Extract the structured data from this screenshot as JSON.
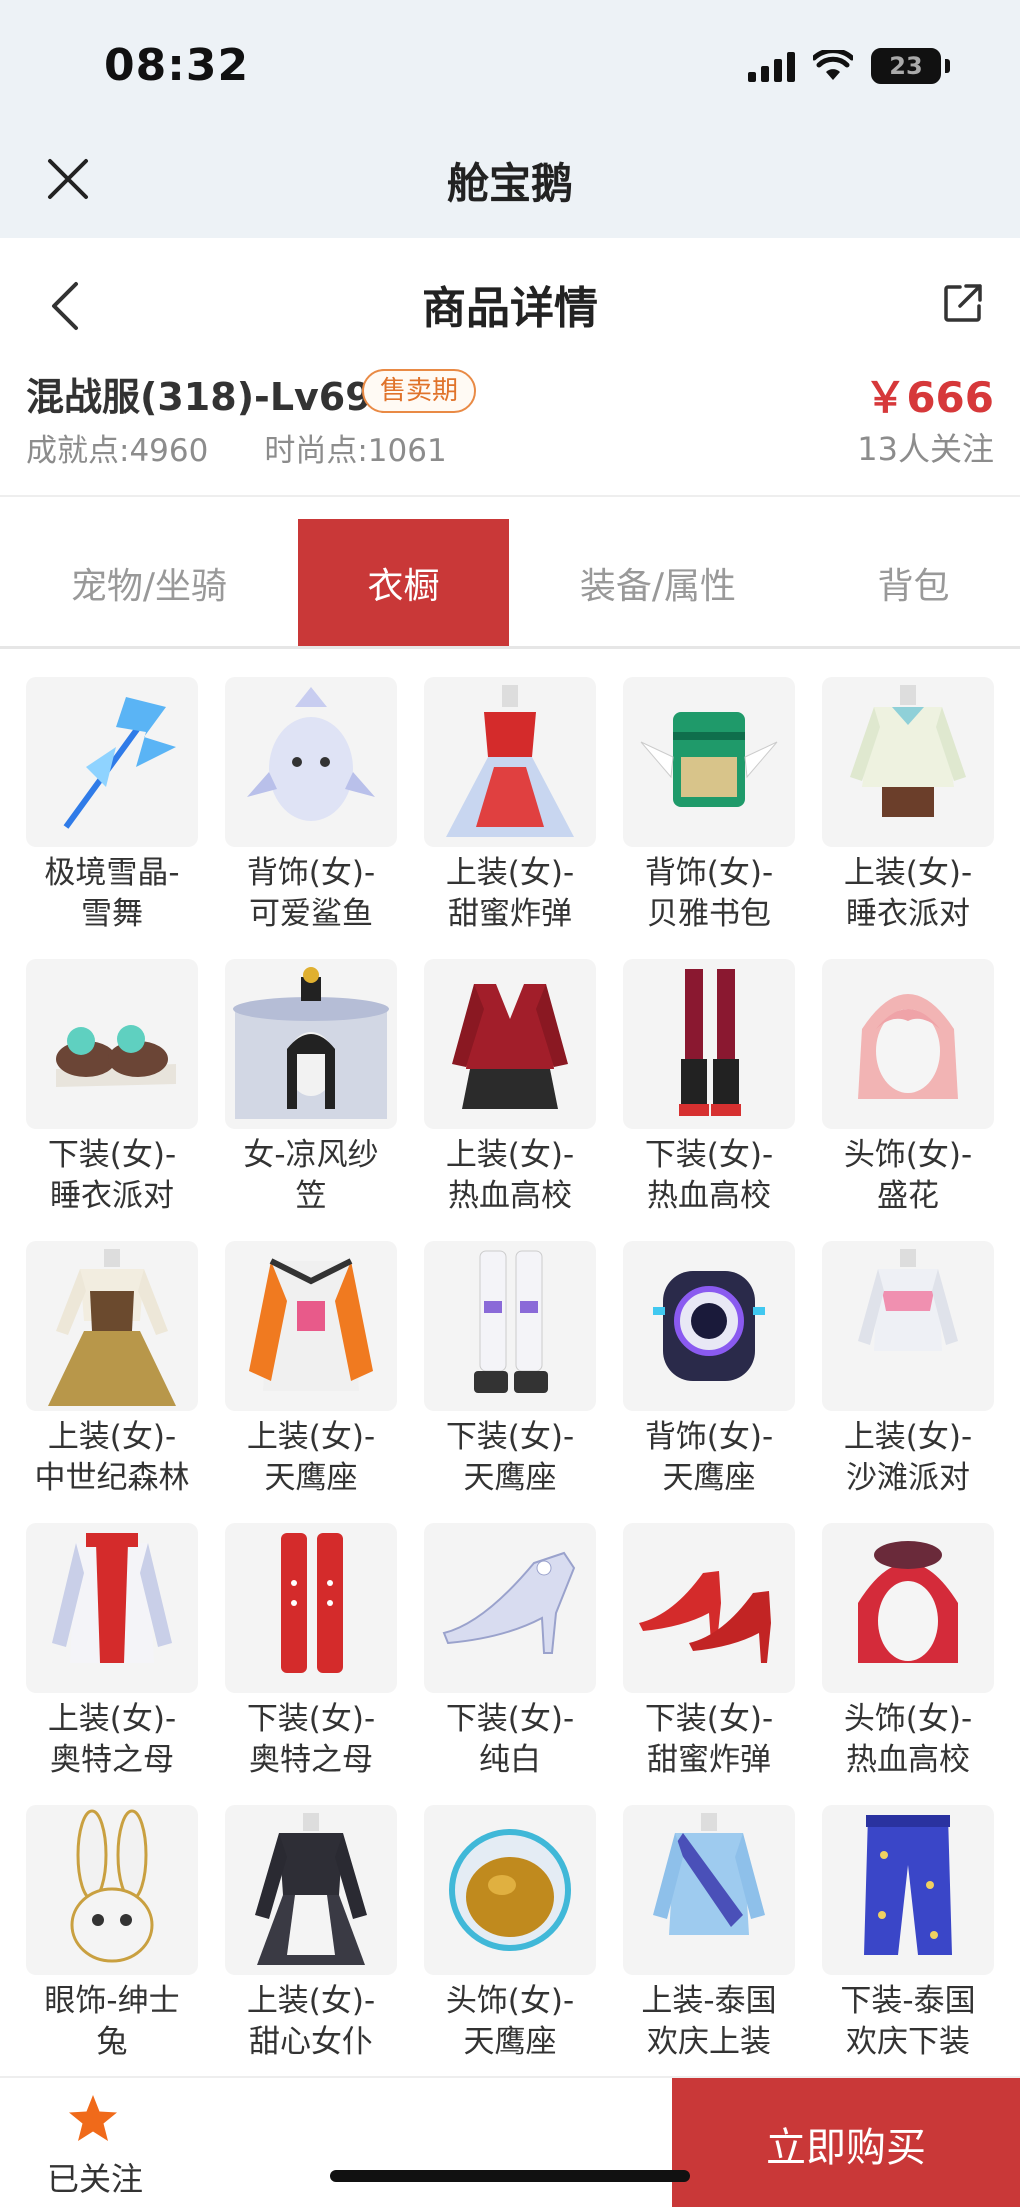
{
  "status_bar": {
    "time": "08:32",
    "battery": "23"
  },
  "app_bar": {
    "title": "舱宝鹅",
    "close_icon": "close-icon"
  },
  "header": {
    "title": "商品详情",
    "back_icon": "chevron-left-icon",
    "share_icon": "share-icon"
  },
  "product": {
    "name": "混战服(318)-Lv69",
    "badge": "售卖期",
    "price": "￥666",
    "achievement": "成就点:4960",
    "fashion": "时尚点:1061",
    "followers": "13人关注"
  },
  "tabs": [
    {
      "label": "宠物/坐骑",
      "active": false
    },
    {
      "label": "衣橱",
      "active": true
    },
    {
      "label": "装备/属性",
      "active": false
    },
    {
      "label": "背包",
      "active": false
    }
  ],
  "items": [
    {
      "line1": "极境雪晶-",
      "line2": "雪舞",
      "icon": "ice-scythe-icon"
    },
    {
      "line1": "背饰(女)-",
      "line2": "可爱鲨鱼",
      "icon": "shark-backpack-icon"
    },
    {
      "line1": "上装(女)-",
      "line2": "甜蜜炸弹",
      "icon": "red-dress-icon"
    },
    {
      "line1": "背饰(女)-",
      "line2": "贝雅书包",
      "icon": "winged-bag-icon"
    },
    {
      "line1": "上装(女)-",
      "line2": "睡衣派对",
      "icon": "pajama-top-icon"
    },
    {
      "line1": "下装(女)-",
      "line2": "睡衣派对",
      "icon": "slippers-icon"
    },
    {
      "line1": "女-凉风纱",
      "line2": "笠",
      "icon": "veil-hat-icon"
    },
    {
      "line1": "上装(女)-",
      "line2": "热血高校",
      "icon": "school-jacket-icon"
    },
    {
      "line1": "下装(女)-",
      "line2": "热血高校",
      "icon": "legs-boots-icon"
    },
    {
      "line1": "头饰(女)-",
      "line2": "盛花",
      "icon": "pink-hair-icon"
    },
    {
      "line1": "上装(女)-",
      "line2": "中世纪森林",
      "icon": "medieval-dress-icon"
    },
    {
      "line1": "上装(女)-",
      "line2": "天鹰座",
      "icon": "orange-suit-icon"
    },
    {
      "line1": "下装(女)-",
      "line2": "天鹰座",
      "icon": "white-boots-icon"
    },
    {
      "line1": "背饰(女)-",
      "line2": "天鹰座",
      "icon": "robot-backpack-icon"
    },
    {
      "line1": "上装(女)-",
      "line2": "沙滩派对",
      "icon": "beach-top-icon"
    },
    {
      "line1": "上装(女)-",
      "line2": "奥特之母",
      "icon": "red-white-top-icon"
    },
    {
      "line1": "下装(女)-",
      "line2": "奥特之母",
      "icon": "red-boots-icon"
    },
    {
      "line1": "下装(女)-",
      "line2": "纯白",
      "icon": "white-heel-icon"
    },
    {
      "line1": "下装(女)-",
      "line2": "甜蜜炸弹",
      "icon": "red-heels-icon"
    },
    {
      "line1": "头饰(女)-",
      "line2": "热血高校",
      "icon": "red-hair-icon"
    },
    {
      "line1": "眼饰-绅士",
      "line2": "兔",
      "icon": "bunny-mask-icon"
    },
    {
      "line1": "上装(女)-",
      "line2": "甜心女仆",
      "icon": "maid-dress-icon"
    },
    {
      "line1": "头饰(女)-",
      "line2": "天鹰座",
      "icon": "helmet-icon"
    },
    {
      "line1": "上装-泰国",
      "line2": "欢庆上装",
      "icon": "thai-top-icon"
    },
    {
      "line1": "下装-泰国",
      "line2": "欢庆下装",
      "icon": "starry-pants-icon"
    }
  ],
  "bottom": {
    "follow_label": "已关注",
    "buy_label": "立即购买"
  },
  "colors": {
    "accent": "#c93838",
    "price": "#d6383a",
    "badge": "#e0732b",
    "star": "#f06a1a"
  }
}
